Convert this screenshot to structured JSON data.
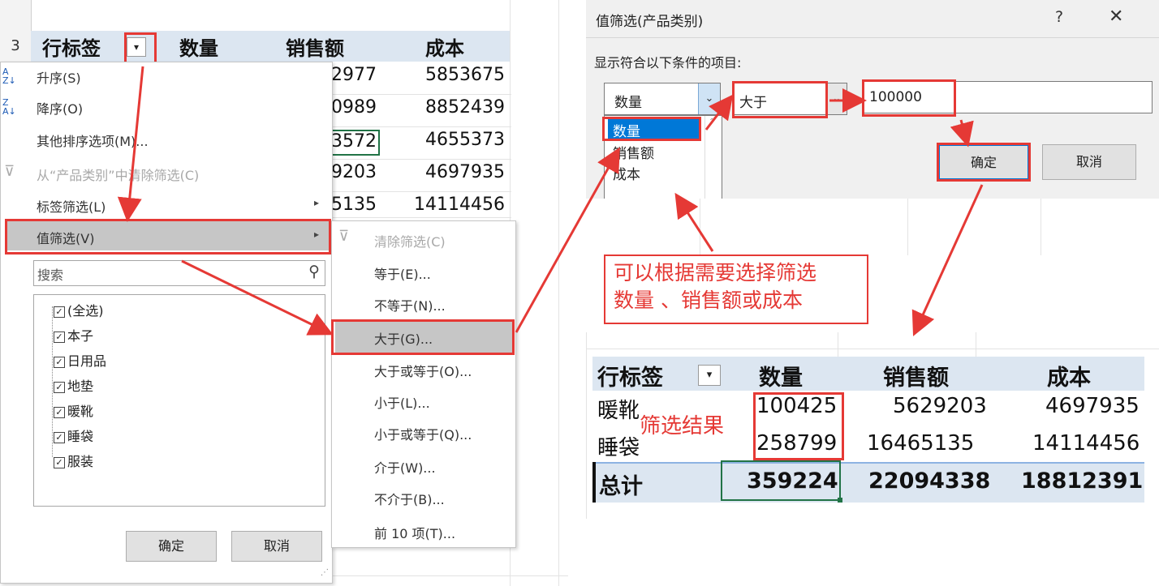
{
  "left_sheet": {
    "row_number": "3",
    "headers": [
      "行标签",
      "数量",
      "销售额",
      "成本"
    ],
    "col_sales_partial": [
      "2977",
      "0989",
      "3572",
      "9203",
      "5135"
    ],
    "col_cost": [
      "5853675",
      "8852439",
      "4655373",
      "4697935",
      "14114456"
    ]
  },
  "sort_menu": {
    "items": [
      "升序(S)",
      "降序(O)",
      "其他排序选项(M)...",
      "从“产品类别”中清除筛选(C)",
      "标签筛选(L)",
      "值筛选(V)"
    ],
    "search_placeholder": "搜索",
    "checklist": [
      "(全选)",
      "本子",
      "日用品",
      "地垫",
      "暖靴",
      "睡袋",
      "服装"
    ],
    "ok_label": "确定",
    "cancel_label": "取消"
  },
  "value_filter_submenu": {
    "items": [
      "清除筛选(C)",
      "等于(E)...",
      "不等于(N)...",
      "大于(G)...",
      "大于或等于(O)...",
      "小于(L)...",
      "小于或等于(Q)...",
      "介于(W)...",
      "不介于(B)...",
      "前 10 项(T)..."
    ]
  },
  "dialog": {
    "title": "值筛选(产品类别)",
    "help": "?",
    "close": "✕",
    "prompt": "显示符合以下条件的项目:",
    "field_value": "数量",
    "field_options": [
      "数量",
      "销售额",
      "成本"
    ],
    "operator_value": "大于",
    "threshold_value": "100000",
    "ok_label": "确定",
    "cancel_label": "取消"
  },
  "annotation_note": {
    "line1": "可以根据需要选择筛选",
    "line2": "数量 、销售额或成本"
  },
  "result_table": {
    "headers": [
      "行标签",
      "数量",
      "销售额",
      "成本"
    ],
    "rows": [
      {
        "label": "暖靴",
        "qty": "100425",
        "sales": "5629203",
        "cost": "4697935"
      },
      {
        "label": "睡袋",
        "qty": "258799",
        "sales": "16465135",
        "cost": "14114456"
      }
    ],
    "total": {
      "label": "总计",
      "qty": "359224",
      "sales": "22094338",
      "cost": "18812391"
    },
    "result_label": "筛选结果"
  },
  "colors": {
    "accent_red": "#e53935",
    "header_blue": "#dce6f1",
    "selection_blue": "#0078d7",
    "excel_green": "#217346"
  }
}
